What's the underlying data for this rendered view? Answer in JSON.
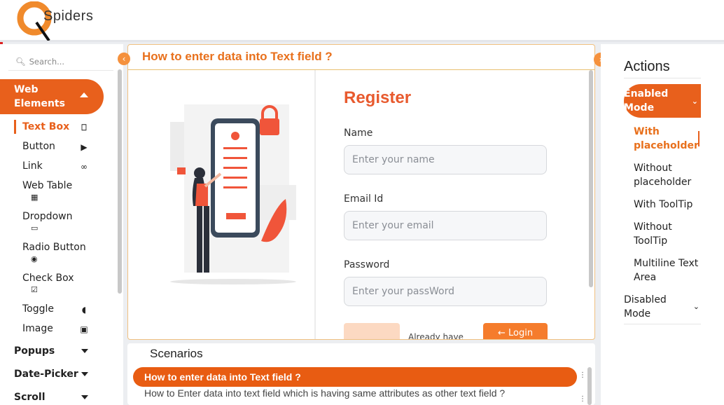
{
  "brand": {
    "logo_text": "Spiders"
  },
  "sidebar": {
    "search_placeholder": "Search...",
    "section_label": "Web Elements",
    "items": [
      {
        "label": "Text Box",
        "icon": "textbox-icon",
        "active": true
      },
      {
        "label": "Button",
        "icon": "play-circle-icon"
      },
      {
        "label": "Link",
        "icon": "link-icon"
      },
      {
        "label": "Web Table",
        "icon": "table-icon"
      },
      {
        "label": "Dropdown",
        "icon": "dropdown-icon"
      },
      {
        "label": "Radio Button",
        "icon": "radio-icon"
      },
      {
        "label": "Check Box",
        "icon": "checkbox-icon"
      },
      {
        "label": "Toggle",
        "icon": "toggle-icon"
      },
      {
        "label": "Image",
        "icon": "image-icon"
      }
    ],
    "categories": [
      {
        "label": "Popups"
      },
      {
        "label": "Date-Picker"
      },
      {
        "label": "Scroll"
      }
    ]
  },
  "main": {
    "title": "How to enter data into Text field ?",
    "form": {
      "heading": "Register",
      "name_label": "Name",
      "name_placeholder": "Enter your name",
      "email_label": "Email Id",
      "email_placeholder": "Enter your email",
      "password_label": "Password",
      "password_placeholder": "Enter your passWord",
      "already_text": "Already have",
      "login_label": "Login"
    }
  },
  "scenarios": {
    "title": "Scenarios",
    "items": [
      "How to enter data into Text field ?",
      "How to Enter data into text field which is having same attributes as other text field ?"
    ]
  },
  "actions": {
    "title": "Actions",
    "enabled_label": "Enabled Mode",
    "items": [
      {
        "label": "With placeholder",
        "active": true
      },
      {
        "label": "Without placeholder"
      },
      {
        "label": "With ToolTip"
      },
      {
        "label": "Without ToolTip"
      },
      {
        "label": "Multiline Text Area"
      }
    ],
    "disabled_label": "Disabled Mode"
  },
  "colors": {
    "accent": "#e8601c",
    "accent_light": "#f5913d",
    "heading": "#e85a2e"
  }
}
